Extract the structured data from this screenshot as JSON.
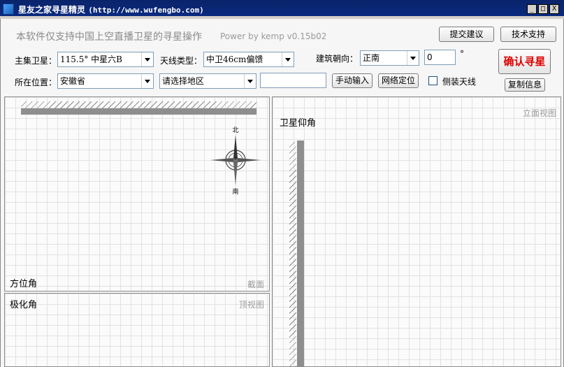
{
  "window": {
    "title": "星友之家寻星精灵",
    "url": "(http://www.wufengbo.com)",
    "minimize_label": "_",
    "maximize_label": "□",
    "close_label": "X"
  },
  "header": {
    "disclaimer": "本软件仅支持中国上空直播卫星的寻星操作",
    "powerby": "Power by kemp  v0.15b02",
    "feedback_button": "提交建议",
    "support_button": "技术支持"
  },
  "form": {
    "satellite_label": "主集卫星：",
    "satellite_value": "115.5°  中星六B",
    "antenna_label": "天线类型：",
    "antenna_value": "中卫46cm偏馈",
    "orientation_label": "建筑朝向：",
    "orientation_value": "正南",
    "orientation_degree": "0",
    "degree_symbol": "°",
    "location_label": "所在位置：",
    "province_value": "安徽省",
    "region_value": "请选择地区",
    "custom_input_value": "",
    "manual_input_button": "手动输入",
    "network_locate_button": "网络定位",
    "side_mount_label": "侧装天线",
    "confirm_button": "确认寻星",
    "copy_info_button": "复制信息"
  },
  "panels": {
    "azimuth": {
      "title": "方位角",
      "tag": "截面"
    },
    "polarization": {
      "title": "极化角",
      "tag": "顶视图"
    },
    "elevation": {
      "title": "卫星仰角",
      "tag": "立面视图"
    }
  },
  "compass": {
    "north": "北",
    "south": "南"
  },
  "colors": {
    "titlebar": "#0a246a",
    "confirm_text": "#e00000",
    "wall": "#8e8e8e",
    "grid_line": "#e2e2e2"
  }
}
